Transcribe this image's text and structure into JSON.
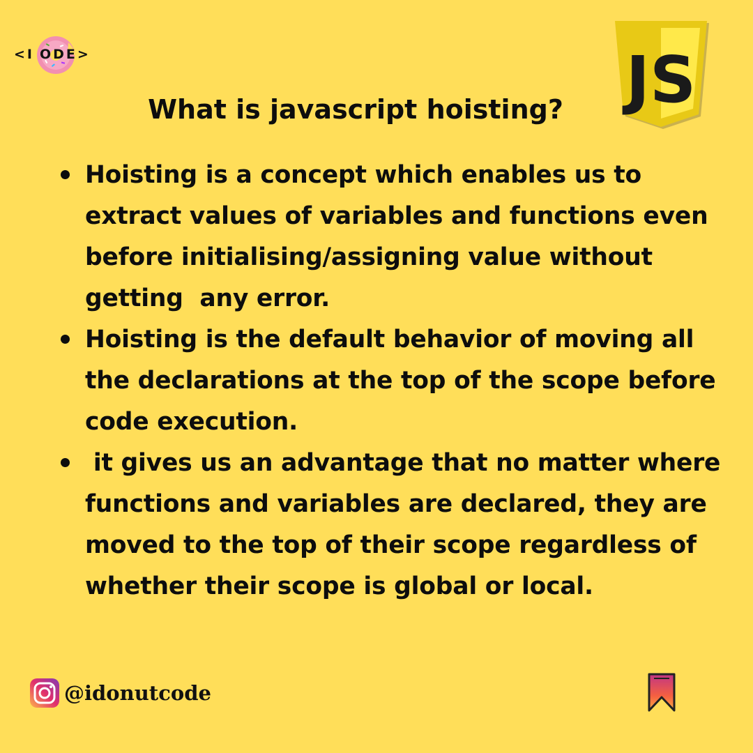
{
  "brand": {
    "logo_left": "<I",
    "logo_right": "ODE>"
  },
  "badge": {
    "label": "JS",
    "icon": "javascript-shield-icon",
    "colors": {
      "outer": "#F5DE19",
      "inner": "#FFE94A",
      "text": "#1a1a1a",
      "shadow": "#2b2b2b"
    }
  },
  "title": "What is javascript hoisting?",
  "bullets": [
    {
      "text": "Hoisting is a concept which enables us to extract values of variables and functions even before initialising/assigning value without getting  any error."
    },
    {
      "text": "Hoisting is the default behavior of moving all the declarations at the top of the scope before code execution."
    },
    {
      "text": " it gives us an advantage that no matter where functions and variables are declared, they are moved to the top of their scope regardless of whether their scope is global or local."
    }
  ],
  "footer": {
    "handle": "@idonutcode",
    "icon": "instagram-icon"
  },
  "bookmark": {
    "icon": "bookmark-icon"
  },
  "colors": {
    "background": "#FFDE59",
    "text": "#0d0d0d"
  }
}
